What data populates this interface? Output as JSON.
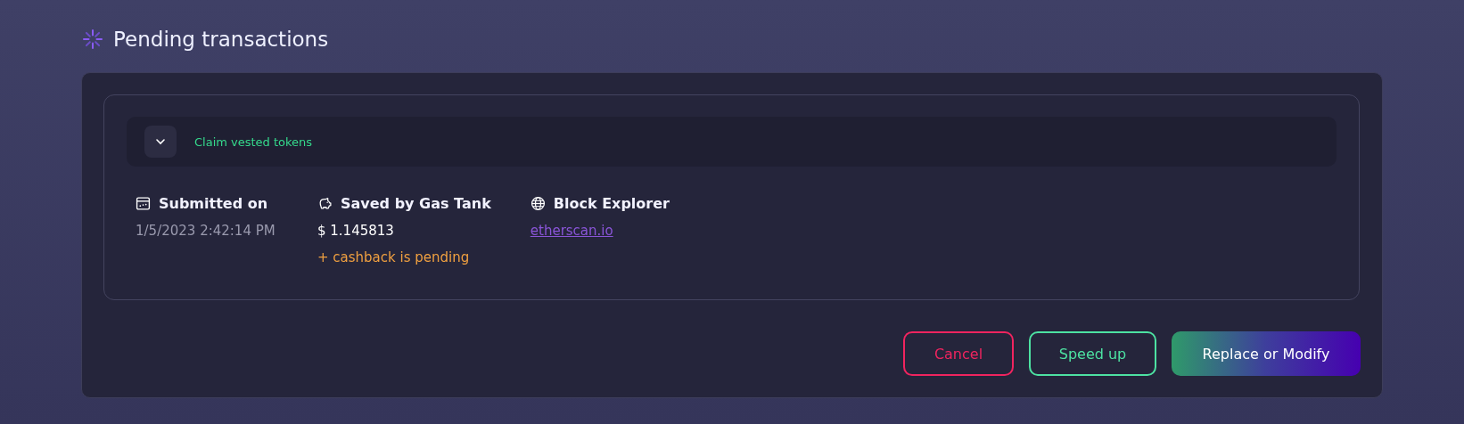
{
  "title": "Pending transactions",
  "transaction": {
    "name": "Claim vested tokens",
    "details": [
      {
        "kind": "calendar",
        "label": "Submitted on",
        "value": "1/5/2023 2:42:14 PM",
        "muted": true,
        "link": false
      },
      {
        "kind": "piggy",
        "label": "Saved by Gas Tank",
        "value": "$ 1.145813",
        "muted": false,
        "link": false,
        "note": "+ cashback is pending"
      },
      {
        "kind": "globe",
        "label": "Block Explorer",
        "value": "etherscan.io",
        "muted": false,
        "link": true
      }
    ]
  },
  "buttons": [
    {
      "label": "Cancel",
      "kind": "danger"
    },
    {
      "label": "Speed up",
      "kind": "outline"
    },
    {
      "label": "Replace or Modify",
      "kind": "primary"
    }
  ]
}
